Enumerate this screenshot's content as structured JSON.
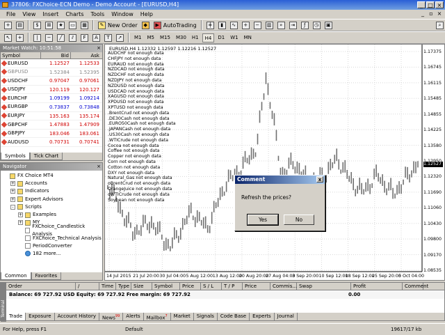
{
  "window": {
    "title": "37806: FXChoice-ECN Demo - Demo Account - [EURUSD,H4]"
  },
  "menu": [
    "File",
    "View",
    "Insert",
    "Charts",
    "Tools",
    "Window",
    "Help"
  ],
  "toolbar": {
    "new_order": "New Order",
    "autotrading": "AutoTrading",
    "timeframes": [
      "M1",
      "M5",
      "M15",
      "M30",
      "H1",
      "H4",
      "D1",
      "W1",
      "MN"
    ],
    "active_timeframe": "H4"
  },
  "market_watch": {
    "title": "Market Watch: 10:51:58",
    "headers": {
      "symbol": "Symbol",
      "bid": "Bid",
      "ask": "Ask"
    },
    "rows": [
      {
        "symbol": "EURUSD",
        "bid": "1.12527",
        "ask": "1.12533",
        "color": "red",
        "grey": false
      },
      {
        "symbol": "GBPUSD",
        "bid": "1.52384",
        "ask": "1.52395",
        "color": "red",
        "grey": true
      },
      {
        "symbol": "USDCHF",
        "bid": "0.97047",
        "ask": "0.97061",
        "color": "red",
        "grey": false
      },
      {
        "symbol": "USDJPY",
        "bid": "120.119",
        "ask": "120.127",
        "color": "red",
        "grey": false
      },
      {
        "symbol": "EURCHF",
        "bid": "1.09199",
        "ask": "1.09214",
        "color": "blue",
        "grey": false
      },
      {
        "symbol": "EURGBP",
        "bid": "0.73837",
        "ask": "0.73848",
        "color": "blue",
        "grey": false
      },
      {
        "symbol": "EURJPY",
        "bid": "135.163",
        "ask": "135.174",
        "color": "red",
        "grey": false
      },
      {
        "symbol": "GBPCHF",
        "bid": "1.47883",
        "ask": "1.47909",
        "color": "red",
        "grey": false
      },
      {
        "symbol": "GBPJPY",
        "bid": "183.046",
        "ask": "183.061",
        "color": "red",
        "grey": false
      },
      {
        "symbol": "AUDUSD",
        "bid": "0.70731",
        "ask": "0.70741",
        "color": "red",
        "grey": false
      }
    ],
    "tabs": [
      "Symbols",
      "Tick Chart"
    ]
  },
  "navigator": {
    "title": "Navigator",
    "items": [
      {
        "label": "FX Choice MT4",
        "level": 0,
        "icon": "folder",
        "exp": ""
      },
      {
        "label": "Accounts",
        "level": 1,
        "icon": "folder",
        "exp": "+"
      },
      {
        "label": "Indicators",
        "level": 1,
        "icon": "folder",
        "exp": "+"
      },
      {
        "label": "Expert Advisors",
        "level": 1,
        "icon": "folder",
        "exp": "+"
      },
      {
        "label": "Scripts",
        "level": 1,
        "icon": "folder",
        "exp": "-"
      },
      {
        "label": "Examples",
        "level": 2,
        "icon": "folder",
        "exp": "+"
      },
      {
        "label": "MY",
        "level": 2,
        "icon": "folder",
        "exp": "+"
      },
      {
        "label": "FXChoice_Candlestick Analysis",
        "level": 2,
        "icon": "doc",
        "exp": ""
      },
      {
        "label": "FXChoice_Technical Analysis",
        "level": 2,
        "icon": "doc",
        "exp": ""
      },
      {
        "label": "PeriodConverter",
        "level": 2,
        "icon": "doc",
        "exp": ""
      },
      {
        "label": "182 more...",
        "level": 2,
        "icon": "globe",
        "exp": ""
      }
    ],
    "tabs": [
      "Common",
      "Favorites"
    ]
  },
  "chart": {
    "header": "EURUSD,H4  1.12332 1.12597 1.12216 1.12527",
    "overlay_lines": [
      "AUDCHF not enough data",
      "CHFJPY not enough data",
      "EURAUD not enough data",
      "NZDCAD not enough data",
      "NZDCHF not enough data",
      "NZDJPY not enough data",
      "NZDUSD not enough data",
      "USDCAD not enough data",
      "XAGUSD not enough data",
      "XPDUSD not enough data",
      "XPTUSD not enough data",
      ".BrentCrud not enough data",
      ".DE30Cash not enough data",
      ".EURO50Cash not enough data",
      ".JAPANCash not enough data",
      ".US30Cash not enough data",
      ".WTICrude not enough data",
      "Cocoa not enough data",
      "Coffee not enough data",
      "Copper not enough data",
      "Corn not enough data",
      "Cotton not enough data",
      "DXY not enough data",
      "Natural_Gas not enough data",
      "oBrentCrud not enough data",
      "OrangeJuice not enough data",
      "oWTICrude not enough data",
      "Soybean not enough data"
    ],
    "y_ticks": [
      "1.17375",
      "1.16745",
      "1.16115",
      "1.15485",
      "1.14855",
      "1.14225",
      "1.13580",
      "1.12950",
      "1.12320",
      "1.11690",
      "1.11060",
      "1.10430",
      "1.09800",
      "1.09170",
      "1.08535"
    ],
    "x_ticks": [
      "14 Jul 2015",
      "21 Jul 20:00",
      "30 Jul 04:00",
      "5 Aug 12:00",
      "13 Aug 12:00",
      "20 Aug 20:00",
      "27 Aug 04:00",
      "3 Sep 20:00",
      "10 Sep 12:00",
      "18 Sep 12:00",
      "25 Sep 20:00",
      "5 Oct 04:00"
    ],
    "current_price": "1.12527"
  },
  "dialog": {
    "title": "Comment",
    "message": "Refresh the prices?",
    "yes": "Yes",
    "no": "No",
    "close": "x"
  },
  "terminal": {
    "headers": [
      "Order",
      "/",
      "Time",
      "Type",
      "Size",
      "Symbol",
      "Price",
      "S / L",
      "T / P",
      "Price",
      "Commis...",
      "Swap",
      "Profit",
      "Comment"
    ],
    "balance_text": "Balance: 69 727.92 USD  Equity: 69 727.92  Free margin: 69 727.92",
    "profit_total": "0.00",
    "tabs": [
      {
        "label": "Trade",
        "badge": ""
      },
      {
        "label": "Exposure",
        "badge": ""
      },
      {
        "label": "Account History",
        "badge": ""
      },
      {
        "label": "News",
        "badge": "99"
      },
      {
        "label": "Alerts",
        "badge": ""
      },
      {
        "label": "Mailbox",
        "badge": "7"
      },
      {
        "label": "Market",
        "badge": ""
      },
      {
        "label": "Signals",
        "badge": ""
      },
      {
        "label": "Code Base",
        "badge": ""
      },
      {
        "label": "Experts",
        "badge": ""
      },
      {
        "label": "Journal",
        "badge": ""
      }
    ],
    "side_label": "Terminal"
  },
  "status": {
    "help": "For Help, press F1",
    "profile": "Default",
    "traffic": "19617/17 kb"
  }
}
